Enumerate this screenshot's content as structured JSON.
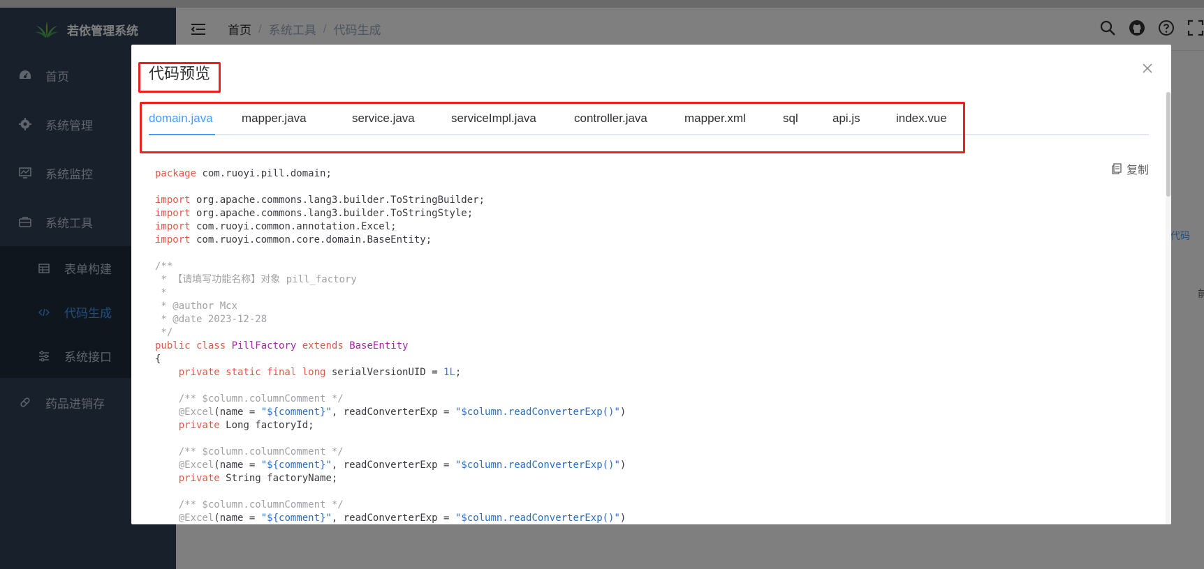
{
  "app": {
    "title": "若依管理系统"
  },
  "sidebar": {
    "items": [
      {
        "label": "首页",
        "icon": "dashboard-icon"
      },
      {
        "label": "系统管理",
        "icon": "gear-icon"
      },
      {
        "label": "系统监控",
        "icon": "monitor-icon"
      },
      {
        "label": "系统工具",
        "icon": "toolbox-icon"
      }
    ],
    "submenu": [
      {
        "label": "表单构建",
        "icon": "table-icon"
      },
      {
        "label": "代码生成",
        "icon": "code-icon"
      },
      {
        "label": "系统接口",
        "icon": "sliders-icon"
      }
    ],
    "last": {
      "label": "药品进销存",
      "icon": "pill-icon"
    }
  },
  "navbar": {
    "breadcrumb": [
      "首页",
      "系统工具",
      "代码生成"
    ],
    "breadcrumb_sep": "/"
  },
  "background": {
    "right_link": "代码",
    "right_text": "前"
  },
  "dialog": {
    "title": "代码预览",
    "tabs": [
      "domain.java",
      "mapper.java",
      "service.java",
      "serviceImpl.java",
      "controller.java",
      "mapper.xml",
      "sql",
      "api.js",
      "index.vue"
    ],
    "active_tab": 0,
    "copy_label": "复制"
  },
  "colors": {
    "accent": "#409eff",
    "sidebar": "#304156",
    "highlight": "#e8231d"
  }
}
